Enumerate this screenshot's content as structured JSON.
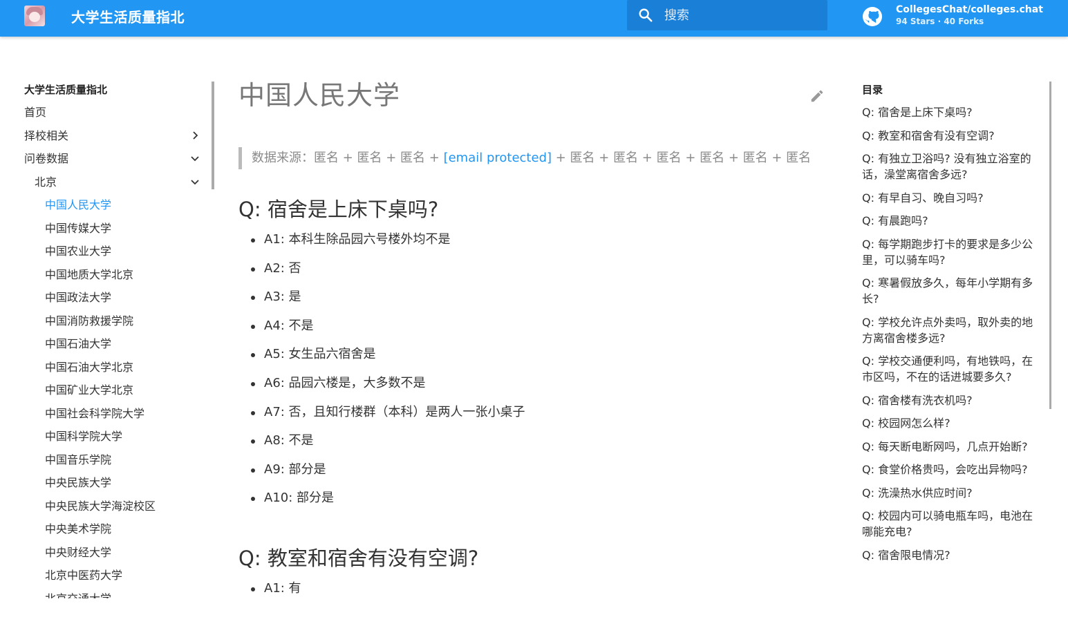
{
  "header": {
    "site_title": "大学生活质量指北",
    "search_placeholder": "搜索",
    "repo_name": "CollegesChat/colleges.chat",
    "repo_facts": "94 Stars · 40 Forks",
    "accent_color": "#2196f3",
    "logo_icon": "anime-avatar-logo",
    "search_icon": "search-icon",
    "repo_icon": "github-icon"
  },
  "sidebar": {
    "title": "大学生活质量指北",
    "items": [
      {
        "label": "首页"
      },
      {
        "label": "择校相关"
      },
      {
        "label": "问卷数据"
      },
      {
        "label": "北京"
      },
      {
        "label": "中国人民大学",
        "active": true
      },
      {
        "label": "中国传媒大学"
      },
      {
        "label": "中国农业大学"
      },
      {
        "label": "中国地质大学北京"
      },
      {
        "label": "中国政法大学"
      },
      {
        "label": "中国消防救援学院"
      },
      {
        "label": "中国石油大学"
      },
      {
        "label": "中国石油大学北京"
      },
      {
        "label": "中国矿业大学北京"
      },
      {
        "label": "中国社会科学院大学"
      },
      {
        "label": "中国科学院大学"
      },
      {
        "label": "中国音乐学院"
      },
      {
        "label": "中央民族大学"
      },
      {
        "label": "中央民族大学海淀校区"
      },
      {
        "label": "中央美术学院"
      },
      {
        "label": "中央财经大学"
      },
      {
        "label": "北京中医药大学"
      },
      {
        "label": "北京交通大学"
      }
    ]
  },
  "main": {
    "page_title": "中国人民大学",
    "source_prefix": "数据来源：匿名 + 匿名 + 匿名 + ",
    "source_email": "[email protected]",
    "source_suffix": " + 匿名 + 匿名 + 匿名 + 匿名 + 匿名 + 匿名",
    "sections": [
      {
        "question": "Q: 宿舍是上床下桌吗?",
        "answers": [
          "A1: 本科生除品园六号楼外均不是",
          "A2: 否",
          "A3: 是",
          "A4: 不是",
          "A5: 女生品六宿舍是",
          "A6: 品园六楼是，大多数不是",
          "A7: 否，且知行楼群（本科）是两人一张小桌子",
          "A8: 不是",
          "A9: 部分是",
          "A10: 部分是"
        ]
      },
      {
        "question": "Q: 教室和宿舍有没有空调?",
        "answers": [
          "A1: 有"
        ]
      }
    ]
  },
  "toc": {
    "title": "目录",
    "items": [
      "Q: 宿舍是上床下桌吗?",
      "Q: 教室和宿舍有没有空调?",
      "Q: 有独立卫浴吗? 没有独立浴室的话，澡堂离宿舍多远?",
      "Q: 有早自习、晚自习吗?",
      "Q: 有晨跑吗?",
      "Q: 每学期跑步打卡的要求是多少公里，可以骑车吗?",
      "Q: 寒暑假放多久，每年小学期有多长?",
      "Q: 学校允许点外卖吗，取外卖的地方离宿舍楼多远?",
      "Q: 学校交通便利吗，有地铁吗，在市区吗，不在的话进城要多久?",
      "Q: 宿舍楼有洗衣机吗?",
      "Q: 校园网怎么样?",
      "Q: 每天断电断网吗，几点开始断?",
      "Q: 食堂价格贵吗，会吃出异物吗?",
      "Q: 洗澡热水供应时间?",
      "Q: 校园内可以骑电瓶车吗，电池在哪能充电?",
      "Q: 宿舍限电情况?"
    ]
  }
}
